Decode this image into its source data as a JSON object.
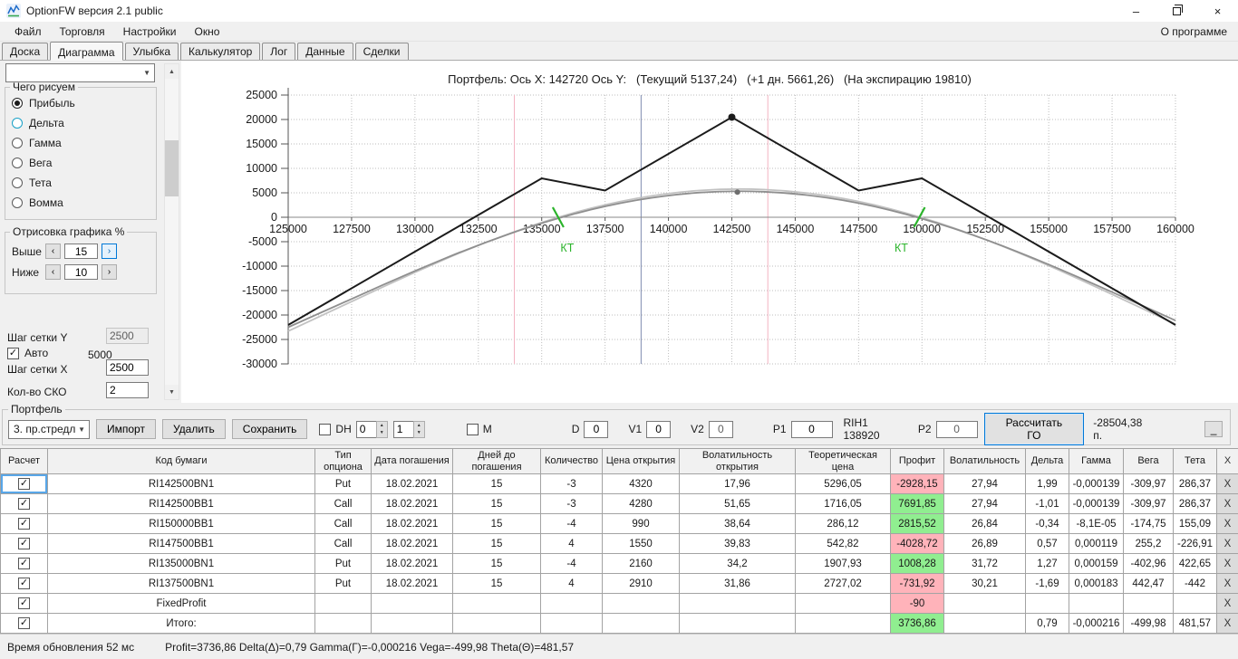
{
  "window": {
    "title": "OptionFW версия 2.1 public",
    "minimize_glyph": "–",
    "close_glyph": "×"
  },
  "glyphs": {
    "check": "✓",
    "spin_up": "▲",
    "spin_down": "▼",
    "combo_arrow": "▼",
    "scroll_up": "▲",
    "scroll_down": "▼",
    "arrow_left": "‹",
    "arrow_right": "›"
  },
  "menu": {
    "items": [
      {
        "label": "Файл",
        "slug": "file"
      },
      {
        "label": "Торговля",
        "slug": "trading"
      },
      {
        "label": "Настройки",
        "slug": "settings"
      },
      {
        "label": "Окно",
        "slug": "window"
      }
    ],
    "right": "О программе"
  },
  "tabs": {
    "active": "Диаграмма",
    "items": [
      {
        "label": "Доска",
        "slug": "board"
      },
      {
        "label": "Диаграмма",
        "slug": "diagram"
      },
      {
        "label": "Улыбка",
        "slug": "smile"
      },
      {
        "label": "Калькулятор",
        "slug": "calculator"
      },
      {
        "label": "Лог",
        "slug": "log"
      },
      {
        "label": "Данные",
        "slug": "data"
      },
      {
        "label": "Сделки",
        "slug": "trades"
      }
    ]
  },
  "left_panel": {
    "top_combo_value": "",
    "draw_group": {
      "title": "Чего рисуем",
      "selected": "Прибыль",
      "hovered": "Дельта",
      "options": [
        {
          "label": "Прибыль",
          "slug": "profit"
        },
        {
          "label": "Дельта",
          "slug": "delta"
        },
        {
          "label": "Гамма",
          "slug": "gamma"
        },
        {
          "label": "Вега",
          "slug": "vega"
        },
        {
          "label": "Тета",
          "slug": "theta"
        },
        {
          "label": "Вомма",
          "slug": "vomma"
        }
      ]
    },
    "render_group": {
      "title": "Отрисовка графика %",
      "above_label": "Выше",
      "above_value": "15",
      "below_label": "Ниже",
      "below_value": "10"
    },
    "grid_y_label": "Шаг сетки Y",
    "grid_y_value": "2500",
    "auto_label": "Авто",
    "auto_checked": true,
    "auto_value": "5000",
    "grid_x_label": "Шаг сетки X",
    "grid_x_value": "2500",
    "sko_label": "Кол-во СКО",
    "sko_value": "2"
  },
  "chart": {
    "type": "line",
    "title": "Портфель: Ось X: 142720 Ось Y:   (Текущий 5137,24)   (+1 дн. 5661,26)   (На экспирацию 19810)",
    "x_range": [
      125000,
      160000
    ],
    "y_range": [
      -30000,
      25000
    ],
    "x_ticks": [
      125000,
      127500,
      130000,
      132500,
      135000,
      137500,
      140000,
      142500,
      145000,
      147500,
      150000,
      152500,
      155000,
      157500,
      160000
    ],
    "y_ticks": [
      25000,
      20000,
      15000,
      10000,
      5000,
      0,
      -5000,
      -10000,
      -15000,
      -20000,
      -25000,
      -30000
    ],
    "vlines": [
      {
        "x": 133920,
        "color": "#f3b3c2",
        "name": "sigma-lower-line"
      },
      {
        "x": 143920,
        "color": "#f3b3c2",
        "name": "sigma-upper-line"
      },
      {
        "x": 138920,
        "color": "#7f8bb0",
        "name": "current-price-line"
      }
    ],
    "series": [
      {
        "name": "plus-1-day",
        "color": "#c2c2c2",
        "width": 1.8,
        "smooth": true,
        "points": [
          [
            125000,
            -23305
          ],
          [
            127500,
            -17234
          ],
          [
            130000,
            -11209
          ],
          [
            132500,
            -5657
          ],
          [
            135000,
            -929
          ],
          [
            137500,
            2699
          ],
          [
            140000,
            5030
          ],
          [
            142500,
            5939
          ],
          [
            145000,
            5381
          ],
          [
            147500,
            3383
          ],
          [
            150000,
            51
          ],
          [
            152500,
            -4436
          ],
          [
            155000,
            -9819
          ],
          [
            157500,
            -15768
          ],
          [
            160000,
            -21870
          ]
        ]
      },
      {
        "name": "current",
        "color": "#8f8f8f",
        "width": 1.8,
        "smooth": true,
        "points": [
          [
            125000,
            -22500
          ],
          [
            127500,
            -16692
          ],
          [
            130000,
            -10929
          ],
          [
            132500,
            -5614
          ],
          [
            135000,
            -1088
          ],
          [
            137500,
            2386
          ],
          [
            140000,
            4619
          ],
          [
            142500,
            5490
          ],
          [
            145000,
            4955
          ],
          [
            147500,
            3041
          ],
          [
            150000,
            -150
          ],
          [
            152500,
            -4445
          ],
          [
            155000,
            -9599
          ],
          [
            157500,
            -15290
          ],
          [
            160000,
            -21128
          ]
        ]
      },
      {
        "name": "expiration",
        "color": "#1b1b1b",
        "width": 2,
        "smooth": false,
        "points": [
          [
            125000,
            -22030
          ],
          [
            135000,
            7970
          ],
          [
            137500,
            5470
          ],
          [
            142500,
            20470
          ],
          [
            147500,
            5470
          ],
          [
            150000,
            7970
          ],
          [
            160000,
            -22030
          ]
        ]
      }
    ],
    "markers": [
      {
        "name": "expiration-peak-marker",
        "x": 142500,
        "y": 20470,
        "r": 4,
        "color": "#1b1b1b"
      },
      {
        "name": "current-value-marker",
        "x": 142720,
        "y": 5137,
        "r": 3,
        "color": "#6e6e6e"
      }
    ],
    "breakevens": [
      {
        "x": 135650,
        "label": "КТ"
      },
      {
        "x": 149900,
        "label": "КТ"
      }
    ],
    "breakeven_color": "#2bb32b"
  },
  "portfolio": {
    "group_title": "Портфель",
    "preset_value": "3. пр.стредл",
    "import_label": "Импорт",
    "delete_label": "Удалить",
    "save_label": "Сохранить",
    "dh_label": "DH",
    "dh_value1": "0",
    "dh_value2": "1",
    "m_label": "М",
    "d_label": "D",
    "d_value": "0",
    "v1_label": "V1",
    "v1_value": "0",
    "v2_label": "V2",
    "v2_value": "0",
    "p1_label": "P1",
    "p1_value": "0",
    "instrument_label": "RIH1 138920",
    "p2_label": "P2",
    "p2_value": "0",
    "calc_go_label": "Рассчитать ГО",
    "go_value": "-28504,38 п.",
    "collapse_label": "_"
  },
  "table": {
    "headers": [
      "Расчет",
      "Код бумаги",
      "Тип опциона",
      "Дата погашения",
      "Дней до погашения",
      "Количество",
      "Цена открытия",
      "Волатильность открытия",
      "Теоретическая цена",
      "Профит",
      "Волатильность",
      "Дельта",
      "Гамма",
      "Вега",
      "Тета",
      "X"
    ],
    "delete_label": "X",
    "focused_row_index": 0,
    "rows": [
      {
        "checked": true,
        "code": "RI142500BN1",
        "type": "Put",
        "date": "18.02.2021",
        "days": "15",
        "qty": "-3",
        "open_price": "4320",
        "open_vol": "17,96",
        "theo_price": "5296,05",
        "profit": "-2928,15",
        "profit_sign": "neg",
        "vol": "27,94",
        "delta": "1,99",
        "gamma": "-0,000139",
        "vega": "-309,97",
        "theta": "286,37"
      },
      {
        "checked": true,
        "code": "RI142500BB1",
        "type": "Call",
        "date": "18.02.2021",
        "days": "15",
        "qty": "-3",
        "open_price": "4280",
        "open_vol": "51,65",
        "theo_price": "1716,05",
        "profit": "7691,85",
        "profit_sign": "pos",
        "vol": "27,94",
        "delta": "-1,01",
        "gamma": "-0,000139",
        "vega": "-309,97",
        "theta": "286,37"
      },
      {
        "checked": true,
        "code": "RI150000BB1",
        "type": "Call",
        "date": "18.02.2021",
        "days": "15",
        "qty": "-4",
        "open_price": "990",
        "open_vol": "38,64",
        "theo_price": "286,12",
        "profit": "2815,52",
        "profit_sign": "pos",
        "vol": "26,84",
        "delta": "-0,34",
        "gamma": "-8,1E-05",
        "vega": "-174,75",
        "theta": "155,09"
      },
      {
        "checked": true,
        "code": "RI147500BB1",
        "type": "Call",
        "date": "18.02.2021",
        "days": "15",
        "qty": "4",
        "open_price": "1550",
        "open_vol": "39,83",
        "theo_price": "542,82",
        "profit": "-4028,72",
        "profit_sign": "neg",
        "vol": "26,89",
        "delta": "0,57",
        "gamma": "0,000119",
        "vega": "255,2",
        "theta": "-226,91"
      },
      {
        "checked": true,
        "code": "RI135000BN1",
        "type": "Put",
        "date": "18.02.2021",
        "days": "15",
        "qty": "-4",
        "open_price": "2160",
        "open_vol": "34,2",
        "theo_price": "1907,93",
        "profit": "1008,28",
        "profit_sign": "pos",
        "vol": "31,72",
        "delta": "1,27",
        "gamma": "0,000159",
        "vega": "-402,96",
        "theta": "422,65"
      },
      {
        "checked": true,
        "code": "RI137500BN1",
        "type": "Put",
        "date": "18.02.2021",
        "days": "15",
        "qty": "4",
        "open_price": "2910",
        "open_vol": "31,86",
        "theo_price": "2727,02",
        "profit": "-731,92",
        "profit_sign": "neg",
        "vol": "30,21",
        "delta": "-1,69",
        "gamma": "0,000183",
        "vega": "442,47",
        "theta": "-442"
      },
      {
        "checked": true,
        "code": "FixedProfit",
        "type": "",
        "date": "",
        "days": "",
        "qty": "",
        "open_price": "",
        "open_vol": "",
        "theo_price": "",
        "profit": "-90",
        "profit_sign": "neg",
        "vol": "",
        "delta": "",
        "gamma": "",
        "vega": "",
        "theta": ""
      },
      {
        "checked": true,
        "code": "Итого:",
        "type": "",
        "date": "",
        "days": "",
        "qty": "",
        "open_price": "",
        "open_vol": "",
        "theo_price": "",
        "profit": "3736,86",
        "profit_sign": "pos",
        "vol": "",
        "delta": "0,79",
        "gamma": "-0,000216",
        "vega": "-499,98",
        "theta": "481,57"
      }
    ]
  },
  "status": {
    "left": "Время обновления 52 мс",
    "right": "Profit=3736,86 Delta(Δ)=0,79 Gamma(Г)=-0,000216 Vega=-499,98 Theta(Θ)=481,57"
  }
}
